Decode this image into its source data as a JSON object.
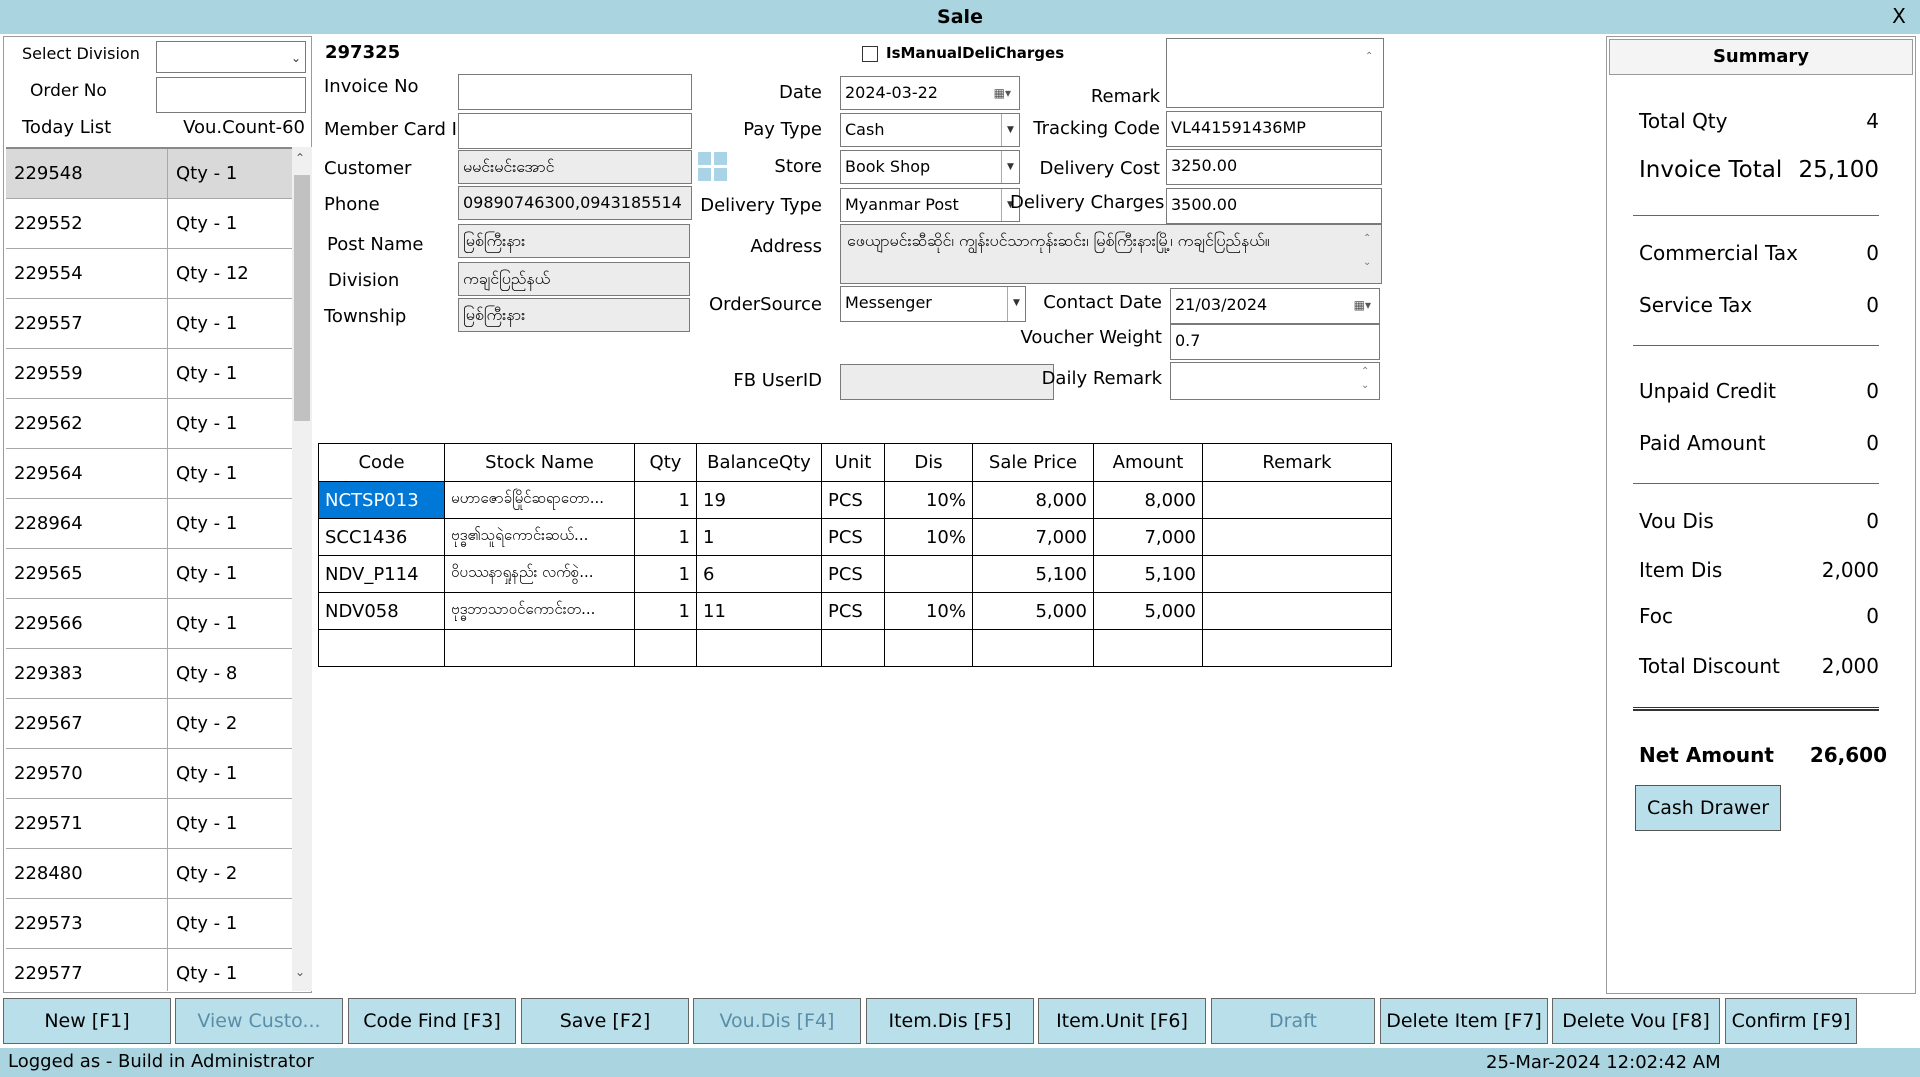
{
  "window": {
    "title": "Sale",
    "close_label": "X"
  },
  "left": {
    "division_label": "Select Division",
    "division_value": "",
    "order_label": "Order No",
    "order_value": "",
    "today_label": "Today List",
    "count_label": "Vou.Count-60",
    "items": [
      {
        "no": "229548",
        "qty": "Qty - 1"
      },
      {
        "no": "229552",
        "qty": "Qty - 1"
      },
      {
        "no": "229554",
        "qty": "Qty - 12"
      },
      {
        "no": "229557",
        "qty": "Qty - 1"
      },
      {
        "no": "229559",
        "qty": "Qty - 1"
      },
      {
        "no": "229562",
        "qty": "Qty - 1"
      },
      {
        "no": "229564",
        "qty": "Qty - 1"
      },
      {
        "no": "228964",
        "qty": "Qty - 1"
      },
      {
        "no": "229565",
        "qty": "Qty - 1"
      },
      {
        "no": "229566",
        "qty": "Qty - 1"
      },
      {
        "no": "229383",
        "qty": "Qty - 8"
      },
      {
        "no": "229567",
        "qty": "Qty - 2"
      },
      {
        "no": "229570",
        "qty": "Qty - 1"
      },
      {
        "no": "229571",
        "qty": "Qty - 1"
      },
      {
        "no": "228480",
        "qty": "Qty - 2"
      },
      {
        "no": "229573",
        "qty": "Qty - 1"
      },
      {
        "no": "229577",
        "qty": "Qty - 1"
      }
    ]
  },
  "form": {
    "voucher_no": "297325",
    "manual_deli_label": "IsManualDeliCharges",
    "invoice_no_label": "Invoice No",
    "invoice_no_value": "",
    "member_card_label": "Member Card ID",
    "member_card_value": "",
    "customer_label": "Customer",
    "customer_value": "မမင်းမင်းအောင်",
    "phone_label": "Phone",
    "phone_value": "09890746300,0943185514",
    "post_name_label": "Post Name",
    "post_name_value": "မြစ်ကြီးနား",
    "division_label": "Division",
    "division_value": "ကချင်ပြည်နယ်",
    "township_label": "Township",
    "township_value": "မြစ်ကြီးနား",
    "date_label": "Date",
    "date_value": "2024-03-22",
    "pay_type_label": "Pay Type",
    "pay_type_value": "Cash",
    "store_label": "Store",
    "store_value": "Book Shop",
    "delivery_type_label": "Delivery Type",
    "delivery_type_value": "Myanmar Post",
    "address_label": "Address",
    "address_value": "ဖေယျာမင်းဆီဆိုင်၊ ကျွန်းပင်သာကုန်းဆင်း၊ မြစ်ကြီးနားမြို့၊ ကချင်ပြည်နယ်။",
    "order_source_label": "OrderSource",
    "order_source_value": "Messenger",
    "fb_user_label": "FB UserID",
    "fb_user_value": "",
    "remark_label": "Remark",
    "remark_value": "",
    "tracking_label": "Tracking Code",
    "tracking_value": "VL441591436MP",
    "delivery_cost_label": "Delivery Cost",
    "delivery_cost_value": "3250.00",
    "delivery_charges_label": "Delivery Charges",
    "delivery_charges_value": "3500.00",
    "contact_date_label": "Contact Date",
    "contact_date_value": "21/03/2024",
    "voucher_weight_label": "Voucher Weight",
    "voucher_weight_value": "0.7",
    "daily_remark_label": "Daily Remark",
    "daily_remark_value": ""
  },
  "grid": {
    "headers": [
      "Code",
      "Stock Name",
      "Qty",
      "BalanceQty",
      "Unit",
      "Dis",
      "Sale Price",
      "Amount",
      "Remark"
    ],
    "rows": [
      {
        "code": "NCTSP013",
        "name": "မဟာဇောခ်မြိုင်ဆရာတော...",
        "qty": "1",
        "bal": "19",
        "unit": "PCS",
        "dis": "10%",
        "price": "8,000",
        "amount": "8,000",
        "remark": ""
      },
      {
        "code": "SCC1436",
        "name": "ဗုဒ္ဓ၏သူရဲကောင်းဆယ်...",
        "qty": "1",
        "bal": "1",
        "unit": "PCS",
        "dis": "10%",
        "price": "7,000",
        "amount": "7,000",
        "remark": ""
      },
      {
        "code": "NDV_P114",
        "name": "ဝိပဿနာရှုနည်း လက်စွဲ...",
        "qty": "1",
        "bal": "6",
        "unit": "PCS",
        "dis": "",
        "price": "5,100",
        "amount": "5,100",
        "remark": ""
      },
      {
        "code": "NDV058",
        "name": "ဗုဒ္ဓဘာသာဝင်ကောင်းတ...",
        "qty": "1",
        "bal": "11",
        "unit": "PCS",
        "dis": "10%",
        "price": "5,000",
        "amount": "5,000",
        "remark": ""
      }
    ]
  },
  "summary": {
    "title": "Summary",
    "total_qty_label": "Total Qty",
    "total_qty": "4",
    "invoice_total_label": "Invoice Total",
    "invoice_total": "25,100",
    "commercial_tax_label": "Commercial Tax",
    "commercial_tax": "0",
    "service_tax_label": "Service Tax",
    "service_tax": "0",
    "unpaid_credit_label": "Unpaid Credit",
    "unpaid_credit": "0",
    "paid_amount_label": "Paid Amount",
    "paid_amount": "0",
    "vou_dis_label": "Vou Dis",
    "vou_dis": "0",
    "item_dis_label": "Item Dis",
    "item_dis": "2,000",
    "foc_label": "Foc",
    "foc": "0",
    "total_discount_label": "Total Discount",
    "total_discount": "2,000",
    "net_amount_label": "Net Amount",
    "net_amount": "26,600",
    "cash_drawer_label": "Cash Drawer"
  },
  "buttons": {
    "new": "New [F1]",
    "view_customer": "View Custo...",
    "code_find": "Code Find [F3]",
    "save": "Save [F2]",
    "vou_dis": "Vou.Dis [F4]",
    "item_dis": "Item.Dis [F5]",
    "item_unit": "Item.Unit [F6]",
    "draft": "Draft",
    "delete_item": "Delete Item [F7]",
    "delete_vou": "Delete Vou [F8]",
    "confirm": "Confirm [F9]"
  },
  "status": {
    "logged_as": "Logged as -",
    "user": "Build in Administrator",
    "datetime": "25-Mar-2024 12:02:42 AM"
  },
  "colors": {
    "title_bar": "#aad4e0",
    "button_bg": "#b9dfea",
    "selection": "#0078d7"
  },
  "icons": {
    "calendar": "calendar-icon",
    "dropdown": "chevron-down-icon",
    "grid": "grid-icon"
  }
}
